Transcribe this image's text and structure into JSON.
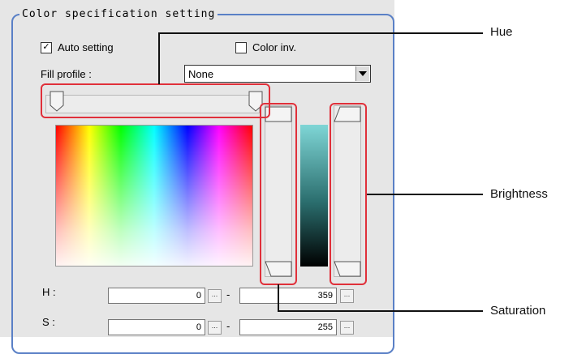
{
  "group": {
    "title": "Color specification setting"
  },
  "auto_setting": {
    "label": "Auto setting",
    "checked": true,
    "mark": "✓"
  },
  "color_inv": {
    "label": "Color inv.",
    "checked": false
  },
  "fill_profile": {
    "label": "Fill profile :",
    "value": "None"
  },
  "fields": {
    "h": {
      "label": "H :",
      "min": "0",
      "max": "359"
    },
    "s": {
      "label": "S :",
      "min": "0",
      "max": "255"
    },
    "dash": "-",
    "dots": "..."
  },
  "callouts": {
    "hue": "Hue",
    "brightness": "Brightness",
    "saturation": "Saturation"
  },
  "colors": {
    "frame": "#5a80c6",
    "highlight": "#e0303a"
  }
}
